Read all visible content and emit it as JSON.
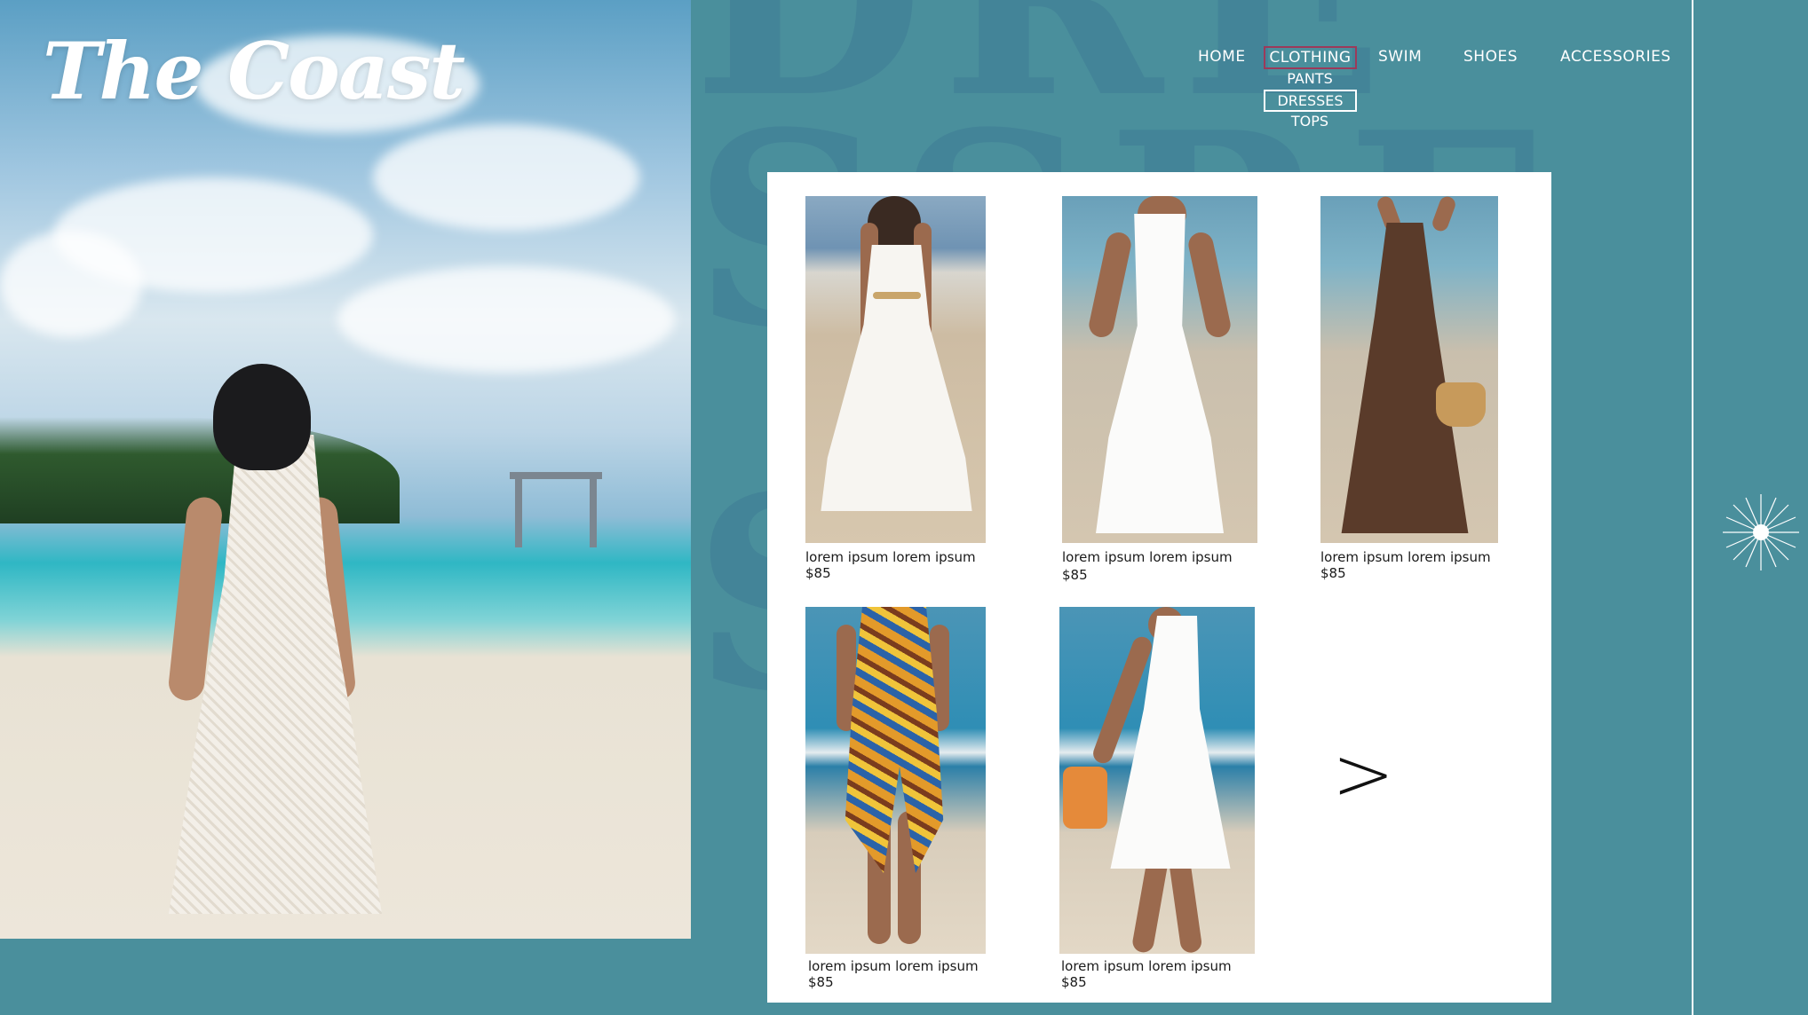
{
  "brand": {
    "logo": "The Coast"
  },
  "nav": {
    "items": [
      {
        "label": "HOME"
      },
      {
        "label": "CLOTHING"
      },
      {
        "label": "SWIM"
      },
      {
        "label": "SHOES"
      },
      {
        "label": "ACCESSORIES"
      }
    ],
    "clothing_submenu": [
      {
        "label": "PANTS"
      },
      {
        "label": "DRESSES"
      },
      {
        "label": "TOPS"
      }
    ],
    "active_item": "CLOTHING",
    "active_subitem": "DRESSES"
  },
  "background_text": {
    "row1": "DRE",
    "row2": "SSRE",
    "row3": "SSRE"
  },
  "products": [
    {
      "caption": "lorem ipsum lorem ipsum",
      "price": "$85"
    },
    {
      "caption": "lorem ipsum lorem ipsum",
      "price": "$85"
    },
    {
      "caption": "lorem ipsum lorem ipsum",
      "price": "$85"
    },
    {
      "caption": "lorem ipsum lorem ipsum",
      "price": "$85"
    },
    {
      "caption": "lorem ipsum lorem ipsum",
      "price": "$85"
    }
  ],
  "pager": {
    "next_label": ">"
  },
  "colors": {
    "background": "#4a8f9c",
    "background_lettering": "#3f7c95",
    "panel": "#ffffff",
    "active_nav_border": "#9c3a5a",
    "text_light": "#ffffff",
    "text_dark": "#1a1a1a"
  }
}
